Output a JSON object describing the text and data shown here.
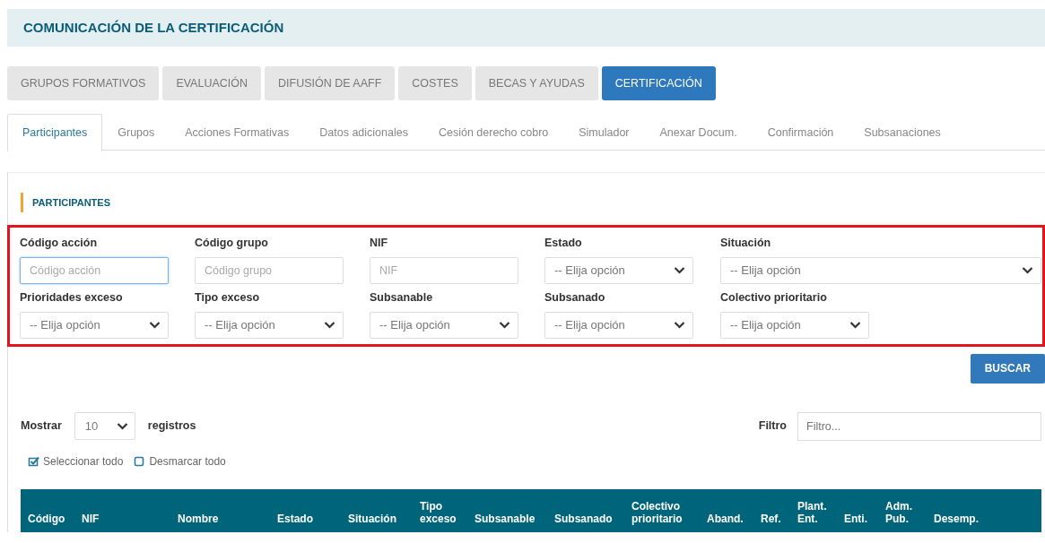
{
  "page_title": "COMUNICACIÓN DE LA CERTIFICACIÓN",
  "main_tabs": [
    {
      "label": "GRUPOS FORMATIVOS",
      "selected": false
    },
    {
      "label": "EVALUACIÓN",
      "selected": false
    },
    {
      "label": "DIFUSIÓN DE AAFF",
      "selected": false
    },
    {
      "label": "COSTES",
      "selected": false
    },
    {
      "label": "BECAS Y AYUDAS",
      "selected": false
    },
    {
      "label": "CERTIFICACIÓN",
      "selected": true
    }
  ],
  "sub_tabs": [
    {
      "label": "Participantes",
      "selected": true
    },
    {
      "label": "Grupos",
      "selected": false
    },
    {
      "label": "Acciones Formativas",
      "selected": false
    },
    {
      "label": "Datos adicionales",
      "selected": false
    },
    {
      "label": "Cesión derecho cobro",
      "selected": false
    },
    {
      "label": "Simulador",
      "selected": false
    },
    {
      "label": "Anexar Docum.",
      "selected": false
    },
    {
      "label": "Confirmación",
      "selected": false
    },
    {
      "label": "Subsanaciones",
      "selected": false
    }
  ],
  "section_title": "PARTICIPANTES",
  "filters": [
    {
      "label": "Código acción",
      "kind": "text",
      "placeholder": "Código acción",
      "focused": true
    },
    {
      "label": "Código grupo",
      "kind": "text",
      "placeholder": "Código grupo",
      "focused": false
    },
    {
      "label": "NIF",
      "kind": "text",
      "placeholder": "NIF",
      "focused": false
    },
    {
      "label": "Estado",
      "kind": "select",
      "value": "-- Elija opción",
      "focused": false
    },
    {
      "label": "Situación",
      "kind": "select",
      "value": "-- Elija opción",
      "focused": false
    },
    {
      "label": "Prioridades exceso",
      "kind": "select",
      "value": "-- Elija opción",
      "focused": false
    },
    {
      "label": "Tipo exceso",
      "kind": "select",
      "value": "-- Elija opción",
      "focused": false
    },
    {
      "label": "Subsanable",
      "kind": "select",
      "value": "-- Elija opción",
      "focused": false
    },
    {
      "label": "Subsanado",
      "kind": "select",
      "value": "-- Elija opción",
      "focused": false
    },
    {
      "label": "Colectivo prioritario",
      "kind": "select",
      "value": "-- Elija opción",
      "focused": false
    }
  ],
  "search_button": "BUSCAR",
  "page_length": {
    "label": "Mostrar",
    "value": "10",
    "suffix": "registros"
  },
  "filter_box": {
    "label": "Filtro",
    "placeholder": "Filtro..."
  },
  "selection_links": [
    {
      "label": "Seleccionar todo",
      "checked": true
    },
    {
      "label": "Desmarcar todo",
      "checked": false
    }
  ],
  "table": {
    "columns": [
      "Código",
      "NIF",
      "Nombre",
      "Estado",
      "Situación",
      "Tipo\nexceso",
      "Subsanable",
      "Subsanado",
      "Colectivo\nprioritario",
      "Aband.",
      "Ref.",
      "Plant.\nEnt.",
      "Enti.",
      "Adm.\nPub.",
      "Desemp."
    ]
  }
}
